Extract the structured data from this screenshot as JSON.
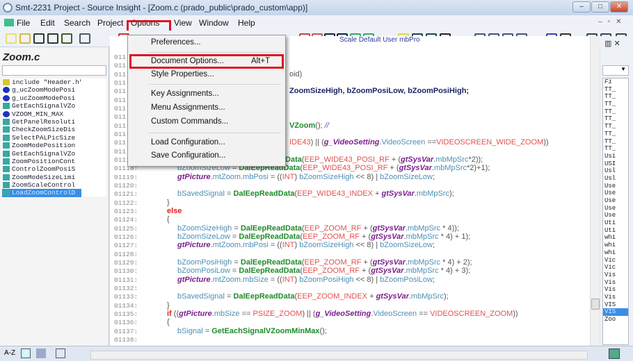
{
  "window": {
    "title": "Smt-2231 Project - Source Insight - [Zoom.c (prado_public\\prado_custom\\app)]",
    "controls": [
      "–",
      "□",
      "✕"
    ]
  },
  "menubar": {
    "items": [
      {
        "label": "File",
        "u": "F"
      },
      {
        "label": "Edit",
        "u": "E"
      },
      {
        "label": "Search",
        "u": "S"
      },
      {
        "label": "Project",
        "u": "P"
      },
      {
        "label": "Options",
        "u": "O"
      },
      {
        "label": "View",
        "u": "V"
      },
      {
        "label": "Window",
        "u": "W"
      },
      {
        "label": "Help",
        "u": "H"
      }
    ],
    "highlighted": "Options",
    "mdi_controls": [
      "–",
      "▫",
      "✕"
    ]
  },
  "options_menu": {
    "items": [
      {
        "label": "Preferences...",
        "u": "P"
      },
      {
        "label": "Document Options...",
        "u": "D",
        "shortcut": "Alt+T",
        "highlighted": true
      },
      {
        "label": "Style Properties...",
        "u": "S"
      },
      {
        "label": "Key Assignments...",
        "u": "K"
      },
      {
        "label": "Menu Assignments...",
        "u": "M"
      },
      {
        "label": "Custom Commands...",
        "u": "C"
      },
      {
        "label": "Load Configuration...",
        "u": "L"
      },
      {
        "label": "Save Configuration...",
        "u": "v"
      }
    ]
  },
  "left_panel": {
    "title": "Zoom.c",
    "symbols": [
      {
        "name": "include \"Header.h\"",
        "kind": "include"
      },
      {
        "name": "g_ucZoomModePosi",
        "kind": "var"
      },
      {
        "name": "g_ucZoomModePosi",
        "kind": "var"
      },
      {
        "name": "GetEachSignalVZo",
        "kind": "func"
      },
      {
        "name": "VZOOM_MIN_MAX",
        "kind": "var"
      },
      {
        "name": "GetPanelResoluti",
        "kind": "func"
      },
      {
        "name": "CheckZoomSizeDis",
        "kind": "func"
      },
      {
        "name": "SelectPALPicSize",
        "kind": "func"
      },
      {
        "name": "ZoomModePosition",
        "kind": "func"
      },
      {
        "name": "GetEachSignalVZo",
        "kind": "func"
      },
      {
        "name": "ZoomPositionCont",
        "kind": "func"
      },
      {
        "name": "ControlZoomPosiS",
        "kind": "func"
      },
      {
        "name": "ZoomModeSizeLimi",
        "kind": "func"
      },
      {
        "name": "ZoomScaleControl",
        "kind": "func"
      },
      {
        "name": "LoadZoomControlD",
        "kind": "func",
        "selected": true
      }
    ],
    "bottom_label": "A-Z"
  },
  "symbol_bar": "Scale      Default      User      mbPro",
  "code": {
    "lines": [
      {
        "n": "011",
        "t": ""
      },
      {
        "n": "011",
        "t": ""
      },
      {
        "n": "011",
        "t": "oid)",
        "hidden": true
      },
      {
        "n": "011",
        "t": ""
      },
      {
        "n": "011",
        "t": "ZoomSizeHigh, bZoomPosiLow, bZoomPosiHigh;",
        "hidden": true,
        "dark": true
      },
      {
        "n": "011",
        "t": ""
      },
      {
        "n": "011",
        "t": ""
      },
      {
        "n": "011",
        "t": ""
      },
      {
        "n": "011",
        "t": "VZoom(); //",
        "hidden": true
      },
      {
        "n": "011",
        "t": ""
      },
      {
        "n": "011",
        "t": "IDE43) || (g_VideoSetting.VideoScreen ==VIDEOSCREEN_WIDE_ZOOM))",
        "hidden": true
      },
      {
        "n": "011",
        "t": ""
      },
      {
        "n": "01117:",
        "t": "        bZoomSizeHigh = DalEepReadData(EEP_WIDE43_POSI_RF + (gtSysVar.mbMpSrc*2));"
      },
      {
        "n": "01118:",
        "t": "        bZoomSizeLow = DalEepReadData(EEP_WIDE43_POSI_RF + (gtSysVar.mbMpSrc*2)+1);"
      },
      {
        "n": "01119:",
        "t": "        gtPicture.mtZoom.mbPosi = ((INT) bZoomSizeHigh << 8) | bZoomSizeLow;"
      },
      {
        "n": "01120:",
        "t": ""
      },
      {
        "n": "01121:",
        "t": "        bSavedSignal = DalEepReadData(EEP_WIDE43_INDEX + gtSysVar.mbMpSrc);"
      },
      {
        "n": "01122:",
        "t": "    }"
      },
      {
        "n": "01123:",
        "t": "    else"
      },
      {
        "n": "01124:",
        "t": "    {"
      },
      {
        "n": "01125:",
        "t": "        bZoomSizeHigh = DalEepReadData(EEP_ZOOM_RF + (gtSysVar.mbMpSrc * 4));"
      },
      {
        "n": "01126:",
        "t": "        bZoomSizeLow = DalEepReadData(EEP_ZOOM_RF + (gtSysVar.mbMpSrc * 4) + 1);"
      },
      {
        "n": "01127:",
        "t": "        gtPicture.mtZoom.mbPosi = ((INT) bZoomSizeHigh << 8) | bZoomSizeLow;"
      },
      {
        "n": "01128:",
        "t": ""
      },
      {
        "n": "01129:",
        "t": "        bZoomPosiHigh = DalEepReadData(EEP_ZOOM_RF + (gtSysVar.mbMpSrc * 4) + 2);"
      },
      {
        "n": "01130:",
        "t": "        bZoomPosiLow = DalEepReadData(EEP_ZOOM_RF + (gtSysVar.mbMpSrc * 4) + 3);"
      },
      {
        "n": "01131:",
        "t": "        gtPicture.mtZoom.mbSize = ((INT) bZoomPosiHigh << 8) | bZoomPosiLow;"
      },
      {
        "n": "01132:",
        "t": ""
      },
      {
        "n": "01133:",
        "t": "        bSavedSignal = DalEepReadData(EEP_ZOOM_INDEX + gtSysVar.mbMpSrc);"
      },
      {
        "n": "01134:",
        "t": "    }"
      },
      {
        "n": "01135:",
        "t": "    if ((gtPicture.mbSize == PSIZE_ZOOM) || (g_VideoSetting.VideoScreen == VIDEOSCREEN_ZOOM))"
      },
      {
        "n": "01136:",
        "t": "    {"
      },
      {
        "n": "01137:",
        "t": "        bSignal = GetEachSignalVZoomMinMax();"
      },
      {
        "n": "01138:",
        "t": ""
      }
    ]
  },
  "right_panel": {
    "header": "Fi",
    "items": [
      "TT_",
      "TT_",
      "TT_",
      "TT_",
      "TT_",
      "TT_",
      "TT_",
      "TT_",
      "TT_",
      "Usi",
      "USI",
      "Usl",
      "Usl",
      "Use",
      "Use",
      "Use",
      "Use",
      "Use",
      "Uti",
      "Uti",
      "whi",
      "whi",
      "whi",
      "Vic",
      "Vic",
      "Vis",
      "Vis",
      "Vis",
      "Vis",
      "VIS",
      "VIS",
      "Zoo"
    ],
    "selected_index": 30
  },
  "colors": {
    "highlight_box": "#e0141e",
    "selection": "#3a8ee6"
  }
}
